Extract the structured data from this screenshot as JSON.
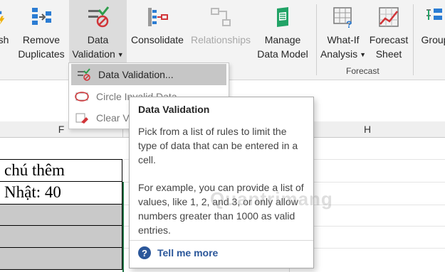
{
  "ribbon": {
    "buttons": [
      {
        "label1": "sh",
        "label2": "l"
      },
      {
        "label1": "Remove",
        "label2": "Duplicates"
      },
      {
        "label1": "Data",
        "label2": "Validation"
      },
      {
        "label1": "Consolidate",
        "label2": ""
      },
      {
        "label1": "Relationships",
        "label2": ""
      },
      {
        "label1": "Manage",
        "label2": "Data Model"
      },
      {
        "label1": "What-If",
        "label2": "Analysis"
      },
      {
        "label1": "Forecast",
        "label2": "Sheet"
      },
      {
        "label1": "Group",
        "label2": ""
      }
    ],
    "forecast_group_label": "Forecast"
  },
  "menu": {
    "items": [
      {
        "label": "Data Validation..."
      },
      {
        "label": "Circle Invalid Data"
      },
      {
        "label": "Clear V"
      }
    ]
  },
  "columns": {
    "f": "F",
    "h": "H"
  },
  "cells": {
    "row1": "chú thêm",
    "row2": "Nhật: 40"
  },
  "tooltip": {
    "title": "Data Validation",
    "p1": "Pick from a list of rules to limit the type of data that can be entered in a cell.",
    "p2": "For example, you can provide a list of values, like 1, 2, and 3, or only allow numbers greater than 1000 as valid entries.",
    "help": "Tell me more"
  },
  "watermark": "Quantrimang"
}
